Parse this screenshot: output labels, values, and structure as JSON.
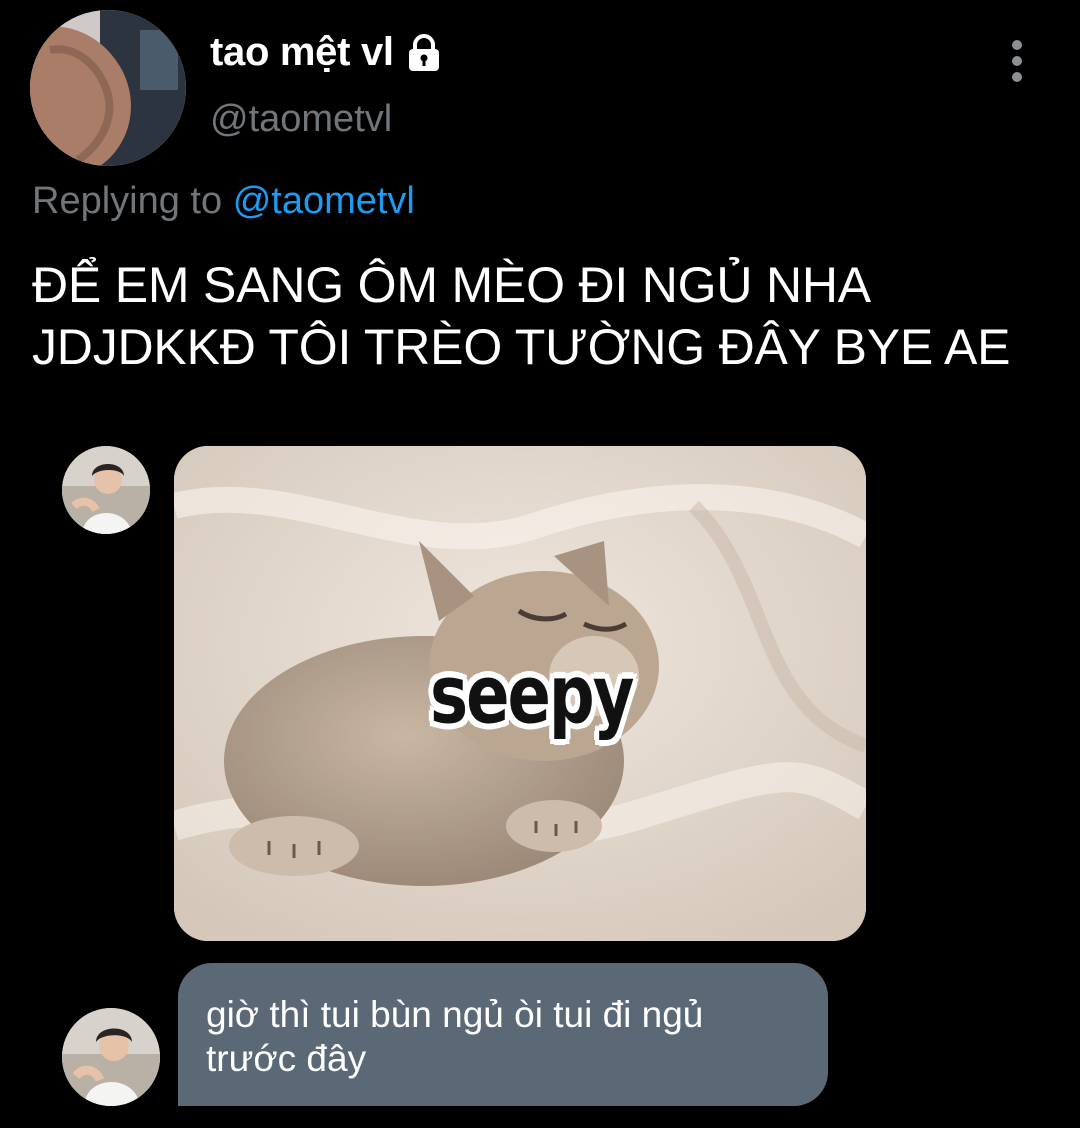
{
  "author": {
    "display_name": "tao mệt vl",
    "handle": "@taometvl",
    "avatar_icon": "avatar-image",
    "locked_icon": "lock-icon"
  },
  "reply": {
    "prefix": "Replying to",
    "target": "@taometvl"
  },
  "tweet": {
    "text": "ĐỂ EM SANG ÔM MÈO ĐI NGỦ NHA JDJDKKĐ TÔI TRÈO TƯỜNG ĐÂY BYE AE"
  },
  "conversation": {
    "sticker_caption": "seepy",
    "message_text": "giờ thì tui bùn ngủ òi tui đi ngủ trước đây"
  },
  "colors": {
    "background": "#000000",
    "secondary_text": "#71767b",
    "link": "#1d9bf0",
    "bubble": "#5b6876"
  }
}
